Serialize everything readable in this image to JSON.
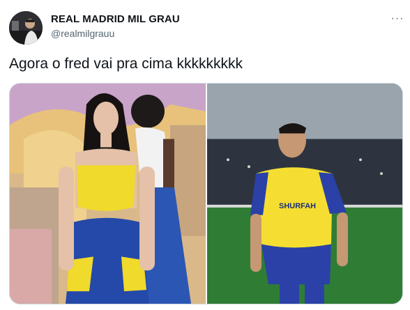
{
  "tweet": {
    "author_name": "REAL MADRID MIL GRAU",
    "author_handle": "@realmilgrauu",
    "text": "Agora o fred vai pra cima kkkkkkkkk",
    "more_icon": "more-horizontal-icon"
  },
  "media": {
    "right_jersey_text": "SHURFAH"
  }
}
